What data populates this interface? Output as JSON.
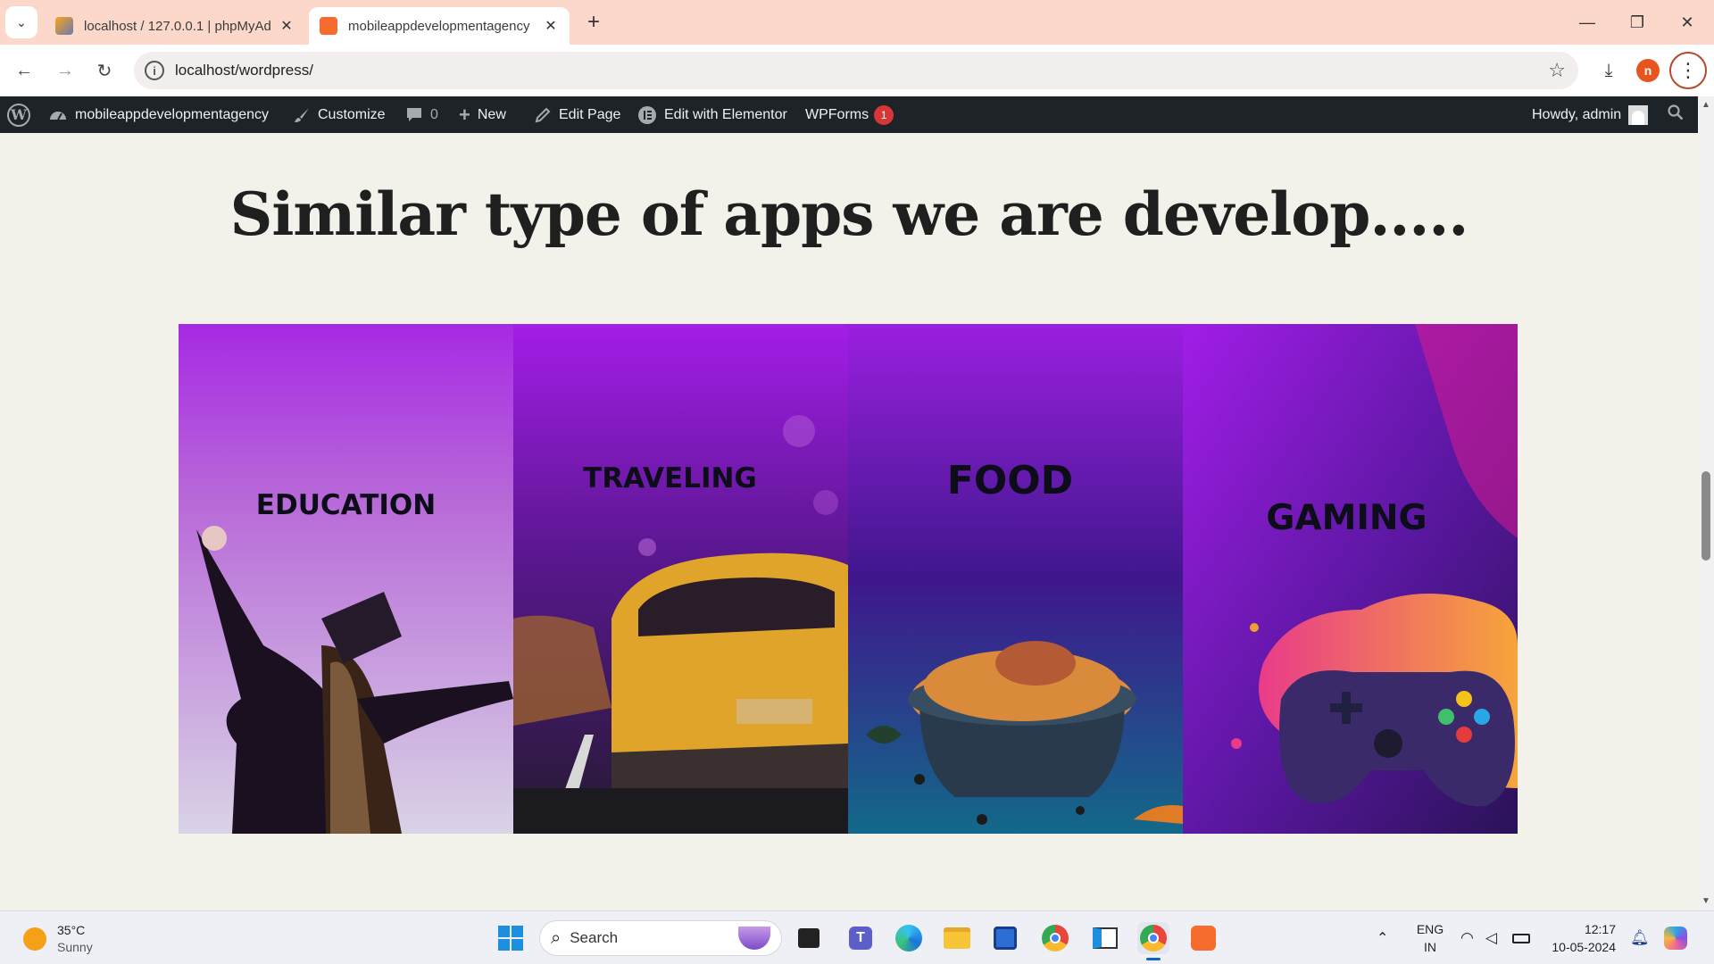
{
  "browser": {
    "tabs": [
      {
        "title": "localhost / 127.0.0.1 | phpMyAd",
        "close": "✕",
        "favicon": "phpmyadmin-icon",
        "active": false
      },
      {
        "title": "mobileappdevelopmentagency",
        "close": "✕",
        "favicon": "xampp-icon",
        "active": true
      }
    ],
    "new_tab": "+",
    "url": "localhost/wordpress/",
    "profile_initial": "n",
    "window": {
      "minimize": "—",
      "restore": "❐",
      "close": "✕"
    }
  },
  "adminbar": {
    "site_name": "mobileappdevelopmentagency",
    "customize": "Customize",
    "comments_count": "0",
    "new": "New",
    "edit_page": "Edit Page",
    "edit_elementor": "Edit with Elementor",
    "wpforms": "WPForms",
    "wpforms_badge": "1",
    "howdy": "Howdy, admin"
  },
  "page": {
    "heading": "Similar type of apps we are develop.....",
    "cards": [
      {
        "label": "EDUCATION",
        "image": "graduate-celebrating-image"
      },
      {
        "label": "TRAVELING",
        "image": "yellow-taxi-image"
      },
      {
        "label": "FOOD",
        "image": "biryani-pot-image"
      },
      {
        "label": "GAMING",
        "image": "game-controller-splash-image"
      }
    ]
  },
  "taskbar": {
    "temperature": "35°C",
    "condition": "Sunny",
    "search_placeholder": "Search",
    "language_top": "ENG",
    "language_bottom": "IN",
    "time": "12:17",
    "date": "10-05-2024"
  },
  "colors": {
    "tabstrip": "#fcd8cb",
    "adminbar": "#1d2327",
    "page_bg": "#f2f2ea",
    "card_gradient_top": "#a41de8",
    "badge": "#d63638"
  }
}
